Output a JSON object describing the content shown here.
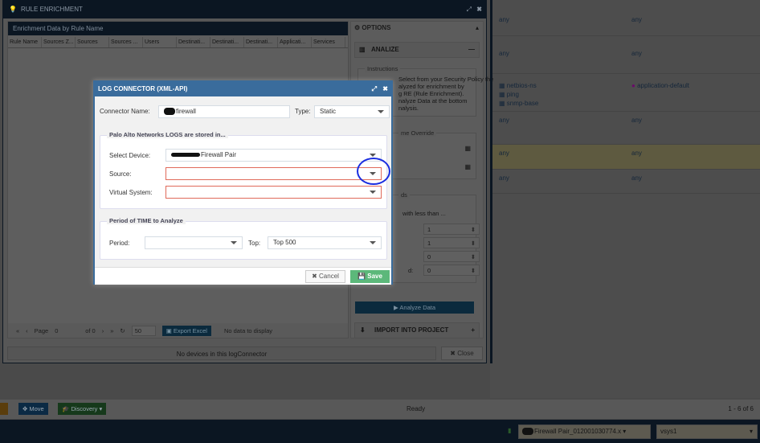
{
  "background_table": {
    "rows": [
      {
        "col1": [
          "any"
        ],
        "col2": "any"
      },
      {
        "col1": [
          "any"
        ],
        "col2": "any"
      },
      {
        "col1": [
          "netbios-ns",
          "ping",
          "snmp-base"
        ],
        "col2": "application-default"
      },
      {
        "col1": [
          "any"
        ],
        "col2": "any"
      },
      {
        "col1": [
          "any"
        ],
        "col2": "any",
        "highlighted": true
      },
      {
        "col1": [
          "any"
        ],
        "col2": "any"
      }
    ]
  },
  "rule_enrichment": {
    "title": "RULE ENRICHMENT",
    "grid_title": "Enrichment Data by Rule Name",
    "columns": [
      "Rule Name",
      "Sources Z...",
      "Sources",
      "Sources ...",
      "Users",
      "Destinati...",
      "Destinati...",
      "Destinati...",
      "Applicati...",
      "Services"
    ],
    "pager": {
      "page_label": "Page",
      "page": "0",
      "of_label": "of 0",
      "page_size": "50",
      "export_label": "Export Excel",
      "no_data": "No data to display"
    },
    "footer_message": "No devices in this logConnector",
    "close_label": "Close",
    "options": {
      "title": "OPTIONS",
      "analize_title": "ANALIZE",
      "instructions_legend": "Instructions",
      "instructions_text": [
        "Select from your Security Policy the",
        "alyzed for enrichment by",
        "g RE (Rule Enrichment).",
        "nalyze Data at the bottom",
        "nalysis."
      ],
      "time_override_legend": "me Override",
      "thresholds_legend": "ds",
      "thresholds_text": "with less than ...",
      "threshold_values": [
        "1",
        "1",
        "0",
        "0"
      ],
      "threshold_last_label": "d:",
      "analyze_button": "Analyze Data",
      "import_title": "IMPORT INTO PROJECT"
    }
  },
  "status_bar": {
    "buttons": [
      "Move",
      "Discovery"
    ],
    "status": "Ready",
    "count": "1 - 6 of 6"
  },
  "bottom_bar": {
    "device_select": "Firewall Pair_012001030774.x",
    "vsys_select": "vsys1"
  },
  "modal": {
    "title": "LOG CONNECTOR (XML-API)",
    "connector_name_label": "Connector Name:",
    "connector_name_value": "firewall",
    "type_label": "Type:",
    "type_value": "Static",
    "logs_legend": "Palo Alto Networks LOGS are stored in...",
    "select_device_label": "Select Device:",
    "select_device_value": "Firewall Pair",
    "source_label": "Source:",
    "source_value": "",
    "vsys_label": "Virtual System:",
    "vsys_value": "",
    "time_legend": "Period of TIME to Analyze",
    "period_label": "Period:",
    "period_value": "",
    "top_label": "Top:",
    "top_value": "Top 500",
    "cancel_label": "Cancel",
    "save_label": "Save"
  },
  "colors": {
    "modal_header": "#3a6c9c",
    "save": "#5cb87a",
    "error_border": "#e06a5a",
    "annotation": "#1a2ee0"
  }
}
